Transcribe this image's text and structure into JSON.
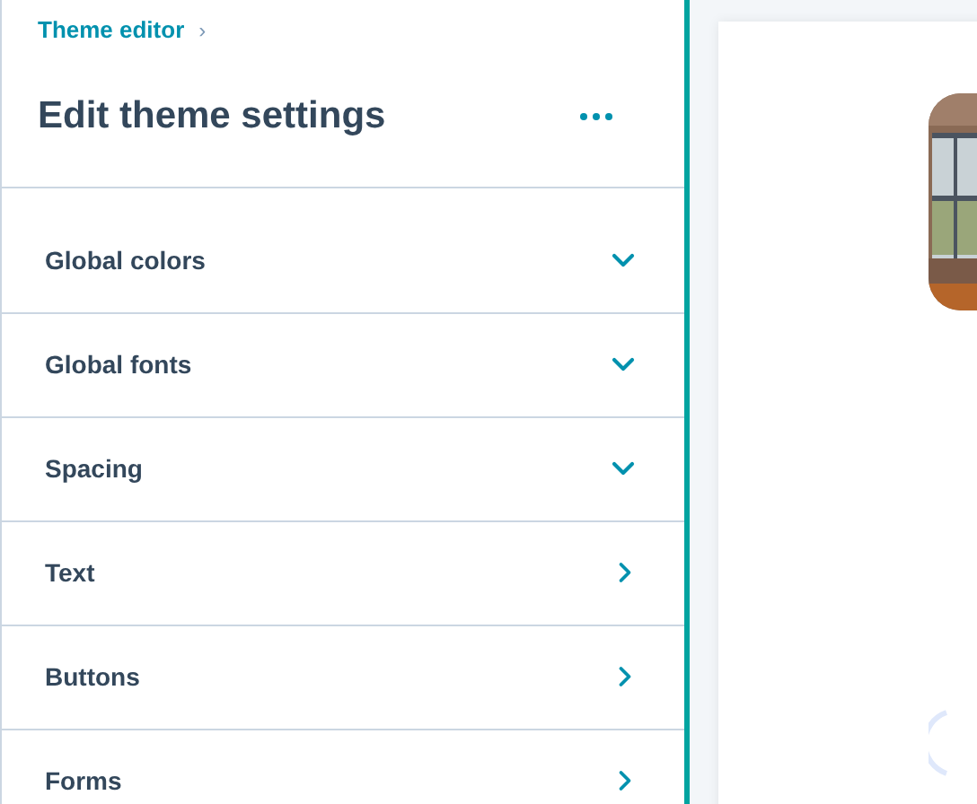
{
  "breadcrumb": {
    "label": "Theme editor",
    "separator": "›"
  },
  "title": "Edit theme settings",
  "settings": [
    {
      "label": "Global colors",
      "kind": "dropdown"
    },
    {
      "label": "Global fonts",
      "kind": "dropdown"
    },
    {
      "label": "Spacing",
      "kind": "dropdown"
    },
    {
      "label": "Text",
      "kind": "page"
    },
    {
      "label": "Buttons",
      "kind": "page"
    },
    {
      "label": "Forms",
      "kind": "page"
    }
  ]
}
